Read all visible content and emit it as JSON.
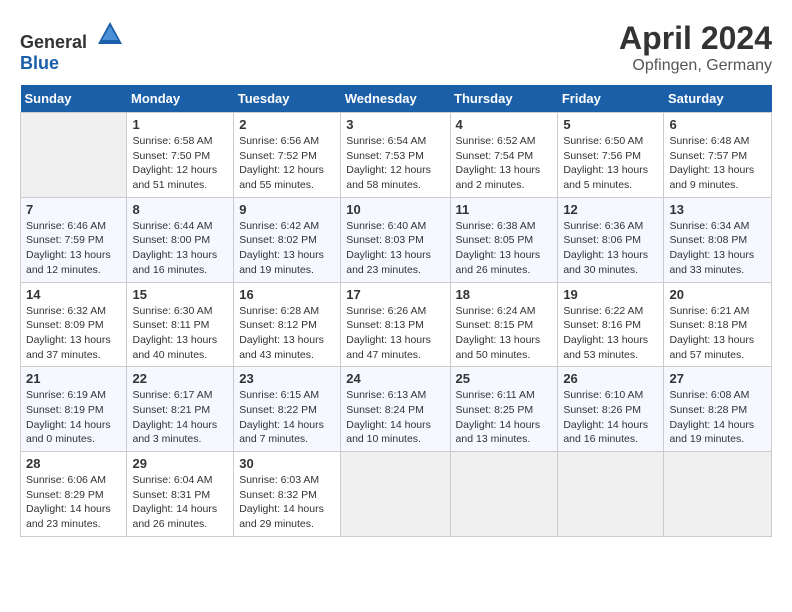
{
  "header": {
    "logo_general": "General",
    "logo_blue": "Blue",
    "month_year": "April 2024",
    "location": "Opfingen, Germany"
  },
  "days_of_week": [
    "Sunday",
    "Monday",
    "Tuesday",
    "Wednesday",
    "Thursday",
    "Friday",
    "Saturday"
  ],
  "weeks": [
    [
      {
        "day": "",
        "info": ""
      },
      {
        "day": "1",
        "info": "Sunrise: 6:58 AM\nSunset: 7:50 PM\nDaylight: 12 hours\nand 51 minutes."
      },
      {
        "day": "2",
        "info": "Sunrise: 6:56 AM\nSunset: 7:52 PM\nDaylight: 12 hours\nand 55 minutes."
      },
      {
        "day": "3",
        "info": "Sunrise: 6:54 AM\nSunset: 7:53 PM\nDaylight: 12 hours\nand 58 minutes."
      },
      {
        "day": "4",
        "info": "Sunrise: 6:52 AM\nSunset: 7:54 PM\nDaylight: 13 hours\nand 2 minutes."
      },
      {
        "day": "5",
        "info": "Sunrise: 6:50 AM\nSunset: 7:56 PM\nDaylight: 13 hours\nand 5 minutes."
      },
      {
        "day": "6",
        "info": "Sunrise: 6:48 AM\nSunset: 7:57 PM\nDaylight: 13 hours\nand 9 minutes."
      }
    ],
    [
      {
        "day": "7",
        "info": "Sunrise: 6:46 AM\nSunset: 7:59 PM\nDaylight: 13 hours\nand 12 minutes."
      },
      {
        "day": "8",
        "info": "Sunrise: 6:44 AM\nSunset: 8:00 PM\nDaylight: 13 hours\nand 16 minutes."
      },
      {
        "day": "9",
        "info": "Sunrise: 6:42 AM\nSunset: 8:02 PM\nDaylight: 13 hours\nand 19 minutes."
      },
      {
        "day": "10",
        "info": "Sunrise: 6:40 AM\nSunset: 8:03 PM\nDaylight: 13 hours\nand 23 minutes."
      },
      {
        "day": "11",
        "info": "Sunrise: 6:38 AM\nSunset: 8:05 PM\nDaylight: 13 hours\nand 26 minutes."
      },
      {
        "day": "12",
        "info": "Sunrise: 6:36 AM\nSunset: 8:06 PM\nDaylight: 13 hours\nand 30 minutes."
      },
      {
        "day": "13",
        "info": "Sunrise: 6:34 AM\nSunset: 8:08 PM\nDaylight: 13 hours\nand 33 minutes."
      }
    ],
    [
      {
        "day": "14",
        "info": "Sunrise: 6:32 AM\nSunset: 8:09 PM\nDaylight: 13 hours\nand 37 minutes."
      },
      {
        "day": "15",
        "info": "Sunrise: 6:30 AM\nSunset: 8:11 PM\nDaylight: 13 hours\nand 40 minutes."
      },
      {
        "day": "16",
        "info": "Sunrise: 6:28 AM\nSunset: 8:12 PM\nDaylight: 13 hours\nand 43 minutes."
      },
      {
        "day": "17",
        "info": "Sunrise: 6:26 AM\nSunset: 8:13 PM\nDaylight: 13 hours\nand 47 minutes."
      },
      {
        "day": "18",
        "info": "Sunrise: 6:24 AM\nSunset: 8:15 PM\nDaylight: 13 hours\nand 50 minutes."
      },
      {
        "day": "19",
        "info": "Sunrise: 6:22 AM\nSunset: 8:16 PM\nDaylight: 13 hours\nand 53 minutes."
      },
      {
        "day": "20",
        "info": "Sunrise: 6:21 AM\nSunset: 8:18 PM\nDaylight: 13 hours\nand 57 minutes."
      }
    ],
    [
      {
        "day": "21",
        "info": "Sunrise: 6:19 AM\nSunset: 8:19 PM\nDaylight: 14 hours\nand 0 minutes."
      },
      {
        "day": "22",
        "info": "Sunrise: 6:17 AM\nSunset: 8:21 PM\nDaylight: 14 hours\nand 3 minutes."
      },
      {
        "day": "23",
        "info": "Sunrise: 6:15 AM\nSunset: 8:22 PM\nDaylight: 14 hours\nand 7 minutes."
      },
      {
        "day": "24",
        "info": "Sunrise: 6:13 AM\nSunset: 8:24 PM\nDaylight: 14 hours\nand 10 minutes."
      },
      {
        "day": "25",
        "info": "Sunrise: 6:11 AM\nSunset: 8:25 PM\nDaylight: 14 hours\nand 13 minutes."
      },
      {
        "day": "26",
        "info": "Sunrise: 6:10 AM\nSunset: 8:26 PM\nDaylight: 14 hours\nand 16 minutes."
      },
      {
        "day": "27",
        "info": "Sunrise: 6:08 AM\nSunset: 8:28 PM\nDaylight: 14 hours\nand 19 minutes."
      }
    ],
    [
      {
        "day": "28",
        "info": "Sunrise: 6:06 AM\nSunset: 8:29 PM\nDaylight: 14 hours\nand 23 minutes."
      },
      {
        "day": "29",
        "info": "Sunrise: 6:04 AM\nSunset: 8:31 PM\nDaylight: 14 hours\nand 26 minutes."
      },
      {
        "day": "30",
        "info": "Sunrise: 6:03 AM\nSunset: 8:32 PM\nDaylight: 14 hours\nand 29 minutes."
      },
      {
        "day": "",
        "info": ""
      },
      {
        "day": "",
        "info": ""
      },
      {
        "day": "",
        "info": ""
      },
      {
        "day": "",
        "info": ""
      }
    ]
  ]
}
